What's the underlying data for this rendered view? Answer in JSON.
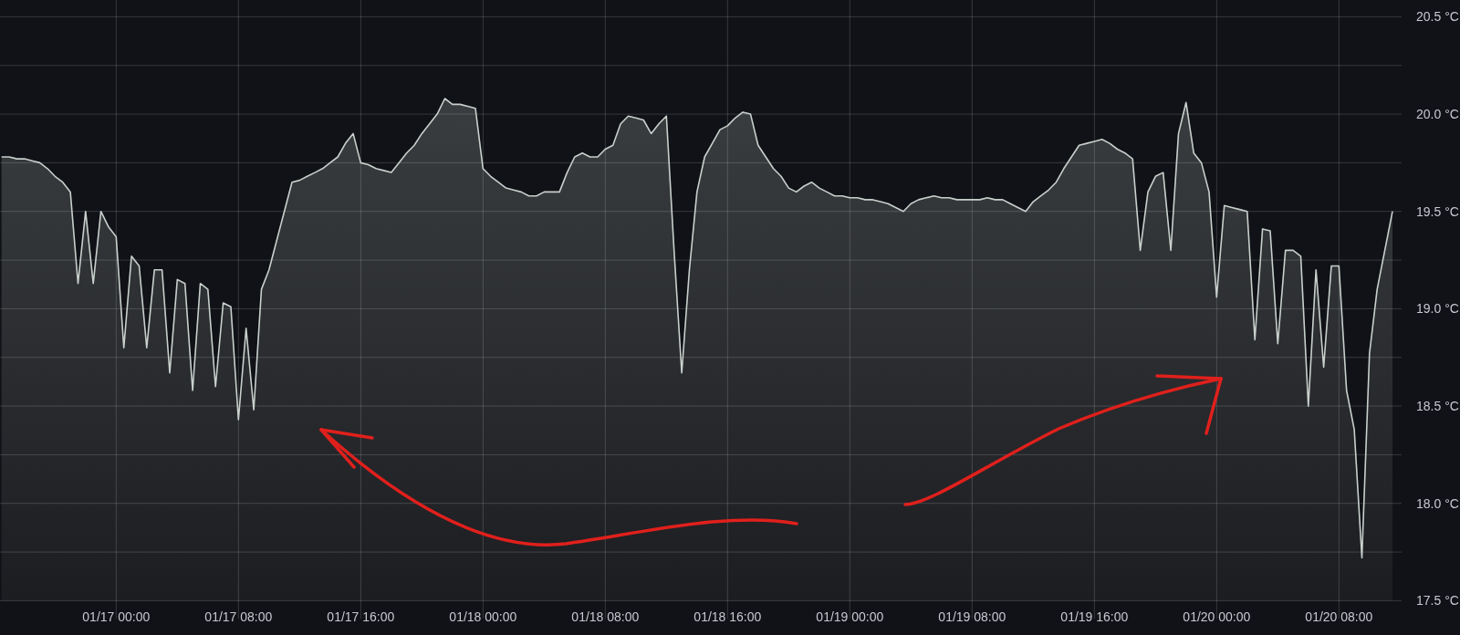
{
  "chart_data": {
    "type": "area",
    "grid": true,
    "categories": [
      null,
      null,
      null,
      null,
      null,
      null,
      null,
      null,
      null,
      null,
      null,
      null,
      null,
      null,
      null,
      "01/17 00:00",
      null,
      null,
      null,
      null,
      null,
      null,
      null,
      null,
      null,
      null,
      null,
      null,
      null,
      null,
      null,
      "01/17 08:00",
      null,
      null,
      null,
      null,
      null,
      null,
      null,
      null,
      null,
      null,
      null,
      null,
      null,
      null,
      null,
      "01/17 16:00",
      null,
      null,
      null,
      null,
      null,
      null,
      null,
      null,
      null,
      null,
      null,
      null,
      null,
      null,
      null,
      "01/18 00:00",
      null,
      null,
      null,
      null,
      null,
      null,
      null,
      null,
      null,
      null,
      null,
      null,
      null,
      null,
      null,
      "01/18 08:00",
      null,
      null,
      null,
      null,
      null,
      null,
      null,
      null,
      null,
      null,
      null,
      null,
      null,
      null,
      null,
      "01/18 16:00",
      null,
      null,
      null,
      null,
      null,
      null,
      null,
      null,
      null,
      null,
      null,
      null,
      null,
      null,
      null,
      "01/19 00:00",
      null,
      null,
      null,
      null,
      null,
      null,
      null,
      null,
      null,
      null,
      null,
      null,
      null,
      null,
      null,
      "01/19 08:00",
      null,
      null,
      null,
      null,
      null,
      null,
      null,
      null,
      null,
      null,
      null,
      null,
      null,
      null,
      null,
      "01/19 16:00",
      null,
      null,
      null,
      null,
      null,
      null,
      null,
      null,
      null,
      null,
      null,
      null,
      null,
      null,
      null,
      "01/20 00:00",
      null,
      null,
      null,
      null,
      null,
      null,
      null,
      null,
      null,
      null,
      null,
      null,
      null,
      null,
      null,
      "01/20 08:00",
      null,
      null,
      null,
      null,
      null,
      null,
      null
    ],
    "series": [
      {
        "color": "#c8d0cc",
        "values": [
          19.78,
          19.78,
          19.77,
          19.77,
          19.76,
          19.75,
          19.72,
          19.68,
          19.65,
          19.6,
          19.13,
          19.5,
          19.13,
          19.5,
          19.42,
          19.37,
          18.8,
          19.27,
          19.22,
          18.8,
          19.2,
          19.2,
          18.67,
          19.15,
          19.13,
          18.58,
          19.13,
          19.1,
          18.6,
          19.03,
          19.01,
          18.43,
          18.9,
          18.48,
          19.1,
          19.2,
          19.35,
          19.5,
          19.65,
          19.66,
          19.68,
          19.7,
          19.72,
          19.75,
          19.78,
          19.85,
          19.9,
          19.75,
          19.74,
          19.72,
          19.71,
          19.7,
          19.75,
          19.8,
          19.84,
          19.9,
          19.95,
          20.0,
          20.08,
          20.05,
          20.05,
          20.04,
          20.03,
          19.72,
          19.68,
          19.65,
          19.62,
          19.61,
          19.6,
          19.58,
          19.58,
          19.6,
          19.6,
          19.6,
          19.7,
          19.78,
          19.8,
          19.78,
          19.78,
          19.82,
          19.84,
          19.95,
          19.99,
          19.98,
          19.97,
          19.9,
          19.95,
          19.99,
          19.3,
          18.67,
          19.2,
          19.6,
          19.78,
          19.85,
          19.92,
          19.94,
          19.98,
          20.01,
          20.0,
          19.84,
          19.78,
          19.72,
          19.68,
          19.62,
          19.6,
          19.63,
          19.65,
          19.62,
          19.6,
          19.58,
          19.58,
          19.57,
          19.57,
          19.56,
          19.56,
          19.55,
          19.54,
          19.52,
          19.5,
          19.54,
          19.56,
          19.57,
          19.58,
          19.57,
          19.57,
          19.56,
          19.56,
          19.56,
          19.56,
          19.57,
          19.56,
          19.56,
          19.54,
          19.52,
          19.5,
          19.55,
          19.58,
          19.61,
          19.65,
          19.72,
          19.78,
          19.84,
          19.85,
          19.86,
          19.87,
          19.85,
          19.82,
          19.8,
          19.77,
          19.3,
          19.6,
          19.68,
          19.7,
          19.3,
          19.9,
          20.06,
          19.8,
          19.75,
          19.6,
          19.06,
          19.53,
          19.52,
          19.51,
          19.5,
          18.84,
          19.41,
          19.4,
          18.82,
          19.3,
          19.3,
          19.27,
          18.5,
          19.2,
          18.7,
          19.22,
          19.22,
          18.58,
          18.38,
          17.72,
          18.77,
          19.1,
          19.3,
          19.5
        ]
      }
    ],
    "ylim": [
      17.5,
      20.5
    ],
    "yticks": [
      {
        "value": 17.5,
        "label": "17.5 °C"
      },
      {
        "value": 18,
        "label": "18.0 °C"
      },
      {
        "value": 18.5,
        "label": "18.5 °C"
      },
      {
        "value": 19,
        "label": "19.0 °C"
      },
      {
        "value": 19.5,
        "label": "19.5 °C"
      },
      {
        "value": 20,
        "label": "20.0 °C"
      },
      {
        "value": 20.5,
        "label": "20.5 °C"
      }
    ]
  }
}
